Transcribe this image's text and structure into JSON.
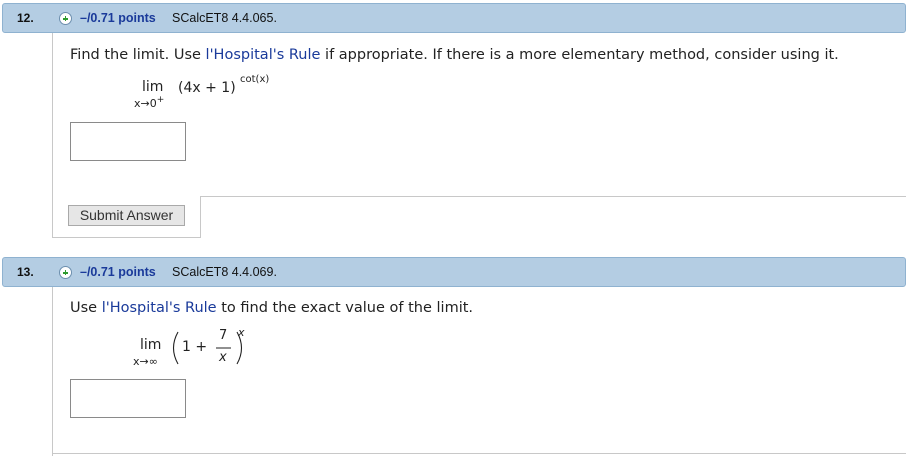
{
  "questions": [
    {
      "number": "12.",
      "points": "–/0.71 points",
      "source": "SCalcET8 4.4.065.",
      "prompt_start": "Find the limit. Use ",
      "prompt_link": "l'Hospital's Rule",
      "prompt_end": " if appropriate. If there is a more elementary method, consider using it.",
      "lim": "lim",
      "lim_sub": "x→0",
      "lim_sub_plus": "+",
      "expr": "(4x + 1)",
      "exponent": "cot(x)",
      "answer_value": "",
      "submit_label": "Submit Answer"
    },
    {
      "number": "13.",
      "points": "–/0.71 points",
      "source": "SCalcET8 4.4.069.",
      "prompt_start": "Use ",
      "prompt_link": "l'Hospital's Rule",
      "prompt_end": " to find the exact value of the limit.",
      "lim": "lim",
      "lim_sub": "x→∞",
      "one_plus": "1 +",
      "numerator": "7",
      "denominator": "x",
      "exponent": "x",
      "answer_value": ""
    }
  ],
  "icons": {
    "expand": "plus-circle-icon"
  },
  "colors": {
    "header_bg": "#b4cde3",
    "link": "#1a3a9a",
    "points": "#1a3a9a",
    "plus": "#2e9b2e"
  }
}
